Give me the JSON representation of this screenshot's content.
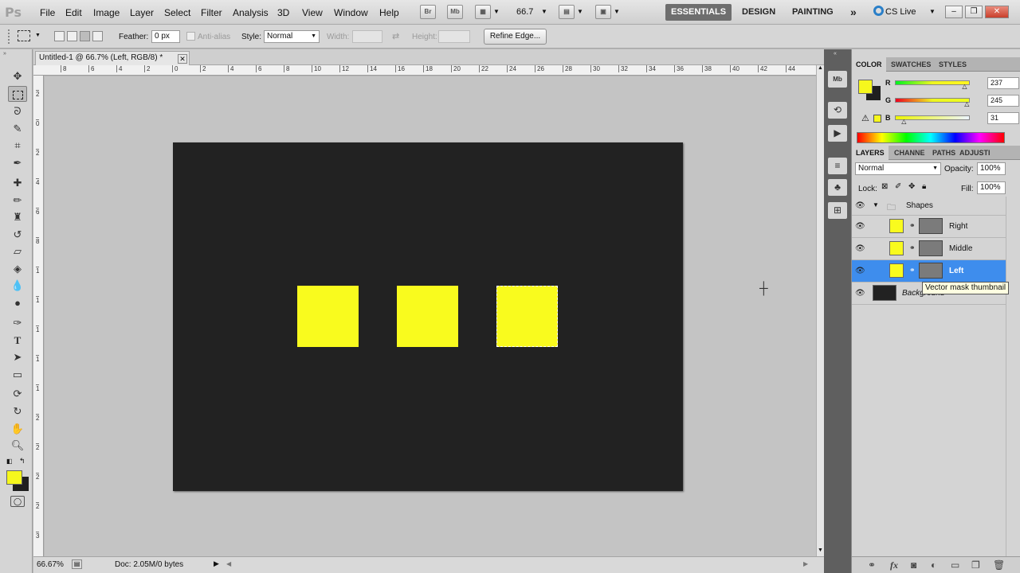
{
  "menubar": {
    "logo": "Ps",
    "items": [
      "File",
      "Edit",
      "Image",
      "Layer",
      "Select",
      "Filter",
      "Analysis",
      "3D",
      "View",
      "Window",
      "Help"
    ],
    "bridge": "Br",
    "minibridge": "Mb",
    "zoom": "66.7",
    "workspaces": [
      "ESSENTIALS",
      "DESIGN",
      "PAINTING"
    ],
    "more": "»",
    "cslive": "CS Live"
  },
  "options": {
    "feather_label": "Feather:",
    "feather_value": "0 px",
    "antialias_label": "Anti-alias",
    "style_label": "Style:",
    "style_value": "Normal",
    "width_label": "Width:",
    "height_label": "Height:",
    "refine_edge": "Refine Edge..."
  },
  "document": {
    "tab_title": "Untitled-1 @ 66.7% (Left, RGB/8) *",
    "canvas_color": "#222222",
    "shape_color": "#f9fb1e"
  },
  "rulers": {
    "top": [
      "8",
      "6",
      "4",
      "2",
      "0",
      "2",
      "4",
      "6",
      "8",
      "10",
      "12",
      "14",
      "16",
      "18",
      "20",
      "22",
      "24",
      "26",
      "28",
      "30",
      "32",
      "34",
      "36",
      "38",
      "40",
      "42",
      "44"
    ],
    "left": [
      "2",
      "0",
      "2",
      "4",
      "6",
      "8",
      "1",
      "1",
      "1",
      "1",
      "1",
      "2",
      "2",
      "2",
      "2",
      "3"
    ]
  },
  "status": {
    "zoom": "66.67%",
    "doc": "Doc: 2.05M/0 bytes"
  },
  "color_panel": {
    "tabs": [
      "COLOR",
      "SWATCHES",
      "STYLES"
    ],
    "r_label": "R",
    "r": "237",
    "r_fraction": 0.93,
    "g_label": "G",
    "g": "245",
    "g_fraction": 0.96,
    "b_label": "B",
    "b": "31",
    "b_fraction": 0.12,
    "foreground": "#eef51f"
  },
  "layers_panel": {
    "tabs": [
      "LAYERS",
      "CHANNE",
      "PATHS",
      "ADJUSTI"
    ],
    "blend_mode": "Normal",
    "opacity_label": "Opacity:",
    "opacity": "100%",
    "lock_label": "Lock:",
    "fill_label": "Fill:",
    "fill": "100%",
    "group": "Shapes",
    "layers": [
      {
        "name": "Right"
      },
      {
        "name": "Middle"
      },
      {
        "name": "Left"
      }
    ],
    "background": "Background",
    "tooltip": "Vector mask thumbnail"
  }
}
